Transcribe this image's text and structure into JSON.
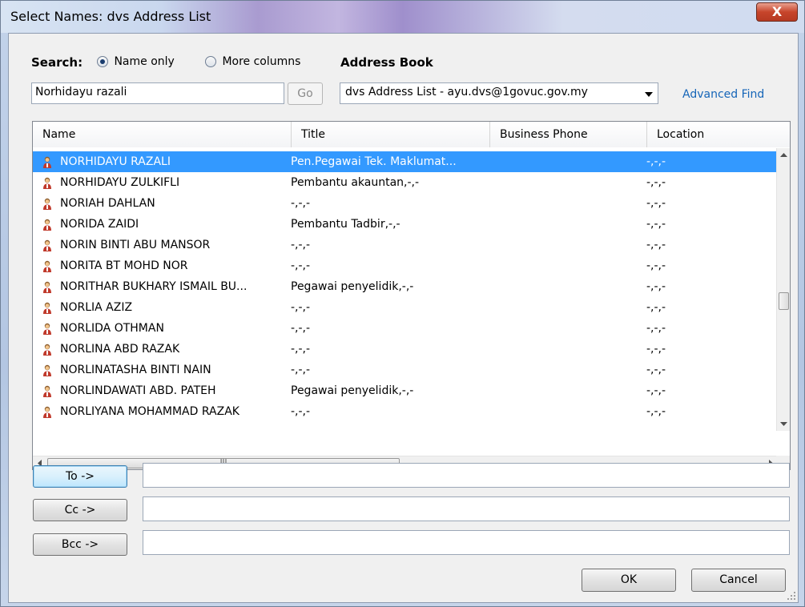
{
  "window": {
    "title": "Select Names: dvs Address List",
    "close_label": "X"
  },
  "search": {
    "label": "Search:",
    "option_name_only": "Name only",
    "option_more_columns": "More columns",
    "value": "Norhidayu razali",
    "go_label": "Go"
  },
  "address_book": {
    "label": "Address Book",
    "selected": "dvs Address List - ayu.dvs@1govuc.gov.my",
    "advanced_find": "Advanced Find"
  },
  "columns": [
    "Name",
    "Title",
    "Business Phone",
    "Location"
  ],
  "rows": [
    {
      "name": "NORHIDAYU RAZALI",
      "title": "Pen.Pegawai Tek. Maklumat...",
      "phone": "",
      "location": "-,-,-",
      "selected": true
    },
    {
      "name": "NORHIDAYU ZULKIFLI",
      "title": "Pembantu akauntan,-,-",
      "phone": "",
      "location": "-,-,-"
    },
    {
      "name": "NORIAH DAHLAN",
      "title": "-,-,-",
      "phone": "",
      "location": "-,-,-"
    },
    {
      "name": "NORIDA ZAIDI",
      "title": "Pembantu Tadbir,-,-",
      "phone": "",
      "location": "-,-,-"
    },
    {
      "name": "NORIN BINTI ABU MANSOR",
      "title": "-,-,-",
      "phone": "",
      "location": "-,-,-"
    },
    {
      "name": "NORITA BT MOHD NOR",
      "title": "-,-,-",
      "phone": "",
      "location": "-,-,-"
    },
    {
      "name": "NORITHAR BUKHARY ISMAIL BU...",
      "title": "Pegawai penyelidik,-,-",
      "phone": "",
      "location": "-,-,-"
    },
    {
      "name": "NORLIA AZIZ",
      "title": "-,-,-",
      "phone": "",
      "location": "-,-,-"
    },
    {
      "name": "NORLIDA OTHMAN",
      "title": "-,-,-",
      "phone": "",
      "location": "-,-,-"
    },
    {
      "name": "NORLINA ABD RAZAK",
      "title": "-,-,-",
      "phone": "",
      "location": "-,-,-"
    },
    {
      "name": "NORLINATASHA BINTI NAIN",
      "title": "-,-,-",
      "phone": "",
      "location": "-,-,-"
    },
    {
      "name": "NORLINDAWATI ABD. PATEH",
      "title": "Pegawai penyelidik,-,-",
      "phone": "",
      "location": "-,-,-"
    },
    {
      "name": "NORLIYANA MOHAMMAD RAZAK",
      "title": "-,-,-",
      "phone": "",
      "location": "-,-,-"
    }
  ],
  "scroll": {
    "hscroll_grip": "III",
    "vertical_position": 0.55
  },
  "recipients": {
    "to_label": "To ->",
    "cc_label": "Cc ->",
    "bcc_label": "Bcc ->",
    "to_value": "",
    "cc_value": "",
    "bcc_value": ""
  },
  "footer": {
    "ok_label": "OK",
    "cancel_label": "Cancel"
  },
  "colors": {
    "selection": "#3399ff",
    "link": "#1565b8",
    "close": "#c7452b"
  }
}
